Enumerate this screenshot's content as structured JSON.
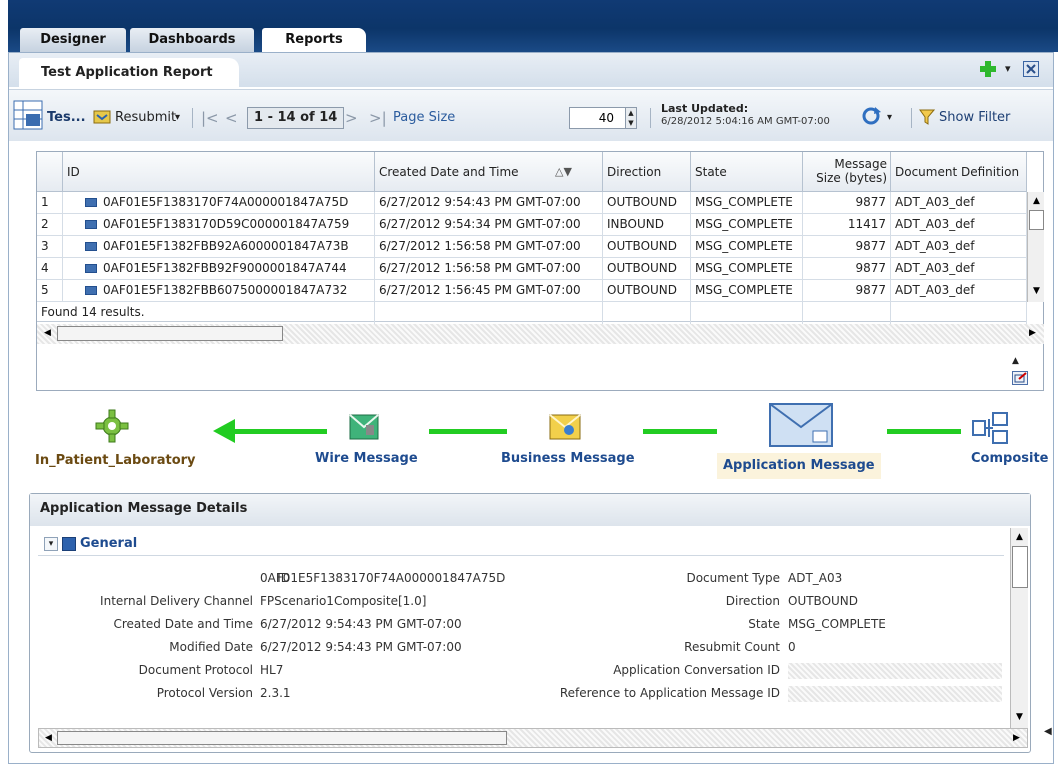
{
  "tabs": [
    "Designer",
    "Dashboards",
    "Reports"
  ],
  "report_tab": "Test Application Report",
  "toolbar": {
    "report_short": "Tes...",
    "resubmit": "Resubmit",
    "dropdown_caret": "▾",
    "page_indicator": "1 - 14 of 14",
    "page_size_label": "Page Size",
    "page_size_value": "40",
    "last_updated_label": "Last Updated:",
    "last_updated_value": "6/28/2012 5:04:16 AM GMT-07:00",
    "show_filter": "Show Filter"
  },
  "columns": [
    "ID",
    "Created Date and Time",
    "Direction",
    "State",
    "Message Size (bytes)",
    "Document Definition"
  ],
  "rows": [
    {
      "n": "1",
      "id": "0AF01E5F1383170F74A000001847A75D",
      "created": "6/27/2012 9:54:43 PM GMT-07:00",
      "direction": "OUTBOUND",
      "state": "MSG_COMPLETE",
      "size": "9877",
      "def": "ADT_A03_def"
    },
    {
      "n": "2",
      "id": "0AF01E5F1383170D59C000001847A759",
      "created": "6/27/2012 9:54:34 PM GMT-07:00",
      "direction": "INBOUND",
      "state": "MSG_COMPLETE",
      "size": "11417",
      "def": "ADT_A03_def"
    },
    {
      "n": "3",
      "id": "0AF01E5F1382FBB92A6000001847A73B",
      "created": "6/27/2012 1:56:58 PM GMT-07:00",
      "direction": "OUTBOUND",
      "state": "MSG_COMPLETE",
      "size": "9877",
      "def": "ADT_A03_def"
    },
    {
      "n": "4",
      "id": "0AF01E5F1382FBB92F9000001847A744",
      "created": "6/27/2012 1:56:58 PM GMT-07:00",
      "direction": "OUTBOUND",
      "state": "MSG_COMPLETE",
      "size": "9877",
      "def": "ADT_A03_def"
    },
    {
      "n": "5",
      "id": "0AF01E5F1382FBB6075000001847A732",
      "created": "6/27/2012 1:56:45 PM GMT-07:00",
      "direction": "OUTBOUND",
      "state": "MSG_COMPLETE",
      "size": "9877",
      "def": "ADT_A03_def"
    }
  ],
  "found": "Found 14 results.",
  "flow": {
    "n1": "In_Patient_Laboratory",
    "n2": "Wire Message",
    "n3": "Business Message",
    "n4": "Application Message",
    "n5": "Composite"
  },
  "details": {
    "title": "Application Message Details",
    "section": "General",
    "left": [
      {
        "label": "ID",
        "value": "0AF01E5F1383170F74A000001847A75D"
      },
      {
        "label": "Internal Delivery Channel",
        "value": "FPScenario1Composite[1.0]"
      },
      {
        "label": "Created Date and Time",
        "value": "6/27/2012 9:54:43 PM GMT-07:00"
      },
      {
        "label": "Modified Date",
        "value": "6/27/2012 9:54:43 PM GMT-07:00"
      },
      {
        "label": "Document Protocol",
        "value": "HL7"
      },
      {
        "label": "Protocol Version",
        "value": "2.3.1"
      }
    ],
    "right": [
      {
        "label": "Document Type",
        "value": "ADT_A03"
      },
      {
        "label": "Direction",
        "value": "OUTBOUND"
      },
      {
        "label": "State",
        "value": "MSG_COMPLETE"
      },
      {
        "label": "Resubmit Count",
        "value": "0"
      },
      {
        "label": "Application Conversation ID",
        "value": ""
      },
      {
        "label": "Reference to Application Message ID",
        "value": ""
      }
    ]
  },
  "colors": {
    "tabbar": "#0c3569",
    "flow_link": "#22cc22",
    "flow_label": "#1e4b8f",
    "composite_label": "#6b4a12"
  }
}
